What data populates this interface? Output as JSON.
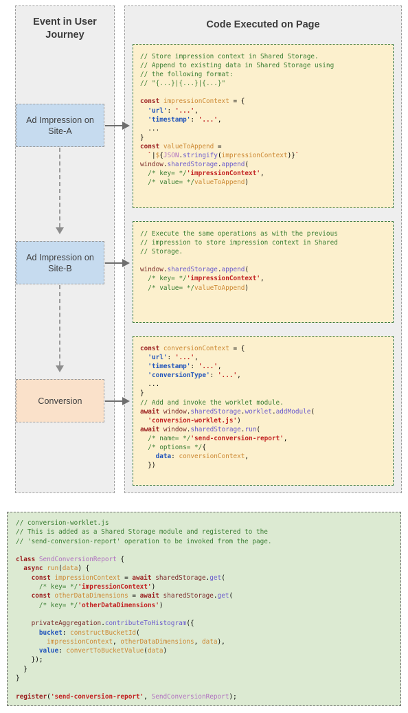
{
  "columns": {
    "event": {
      "title": "Event in User Journey"
    },
    "code": {
      "title": "Code Executed on Page"
    }
  },
  "nodes": [
    {
      "id": "ad-impression-site-a",
      "label": "Ad Impression\non Site-A",
      "color": "#c6dbef"
    },
    {
      "id": "ad-impression-site-b",
      "label": "Ad Impression\non Site-B",
      "color": "#c6dbef"
    },
    {
      "id": "conversion",
      "label": "Conversion",
      "color": "#fae1ca"
    }
  ],
  "code_blocks": {
    "impression_a": "// Store impression context in Shared Storage.\n// Append to existing data in Shared Storage using\n// the following format:\n// \"{...}|{...}|{...}\"\n\nconst impressionContext = {\n  'url': '...',\n  'timestamp': '...',\n  ...\n}\nconst valueToAppend =\n  `|${JSON.stringify(impressionContext)}`\nwindow.sharedStorage.append(\n  /* key= */'impressionContext',\n  /* value= */valueToAppend)",
    "impression_b": "// Execute the same operations as with the previous\n// impression to store impression context in Shared\n// Storage.\n\nwindow.sharedStorage.append(\n  /* key= */'impressionContext',\n  /* value= */valueToAppend)",
    "conversion": "const conversionContext = {\n  'url': '...',\n  'timestamp': '...',\n  'conversionType': '...',\n  ...\n}\n// Add and invoke the worklet module.\nawait window.sharedStorage.worklet.addModule(\n  'conversion-worklet.js')\nawait window.sharedStorage.run(\n  /* name= */'send-conversion-report',\n  /* options= */{\n    data: conversionContext,\n  })",
    "worklet": "// conversion-worklet.js\n// This is added as a Shared Storage module and registered to the\n// 'send-conversion-report' operation to be invoked from the page.\n\nclass SendConversionReport {\n  async run(data) {\n    const impressionContext = await sharedStorage.get(\n      /* key= */'impressionContext')\n    const otherDataDimensions = await sharedStorage.get(\n      /* key= */'otherDataDimensions')\n\n    privateAggregation.contributeToHistogram({\n      bucket: constructBucketId(\n        impressionContext, otherDataDimensions, data),\n      value: convertToBucketValue(data)\n    });\n  }\n}\n\nregister('send-conversion-report', SendConversionReport);"
  },
  "colors": {
    "column_background": "#eeeeee",
    "code_yellow_background": "#fcf0cd",
    "code_yellow_border": "#3f7a3f",
    "code_green_background": "#dcead2",
    "code_green_border": "#6a6a6a",
    "node_blue": "#c6dbef",
    "node_orange": "#fae1ca",
    "comment": "#3a7d32",
    "keyword": "#9c2222",
    "string": "#c22222",
    "object_key": "#2255bb",
    "identifier": "#cc8833",
    "method": "#6a5acd"
  }
}
